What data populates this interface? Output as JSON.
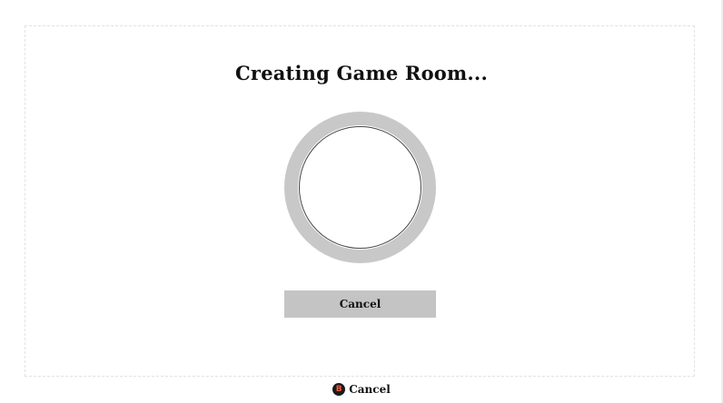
{
  "dialog": {
    "title": "Creating Game Room...",
    "cancel_button_label": "Cancel"
  },
  "footer": {
    "button_glyph": "B",
    "action_label": "Cancel"
  },
  "icons": {
    "spinner": "loading-ring-icon",
    "controller_button": "b-button-icon"
  },
  "colors": {
    "ring": "#c8c8c8",
    "button": "#c4c4c4",
    "b_button_glyph": "#ff5a3a"
  }
}
